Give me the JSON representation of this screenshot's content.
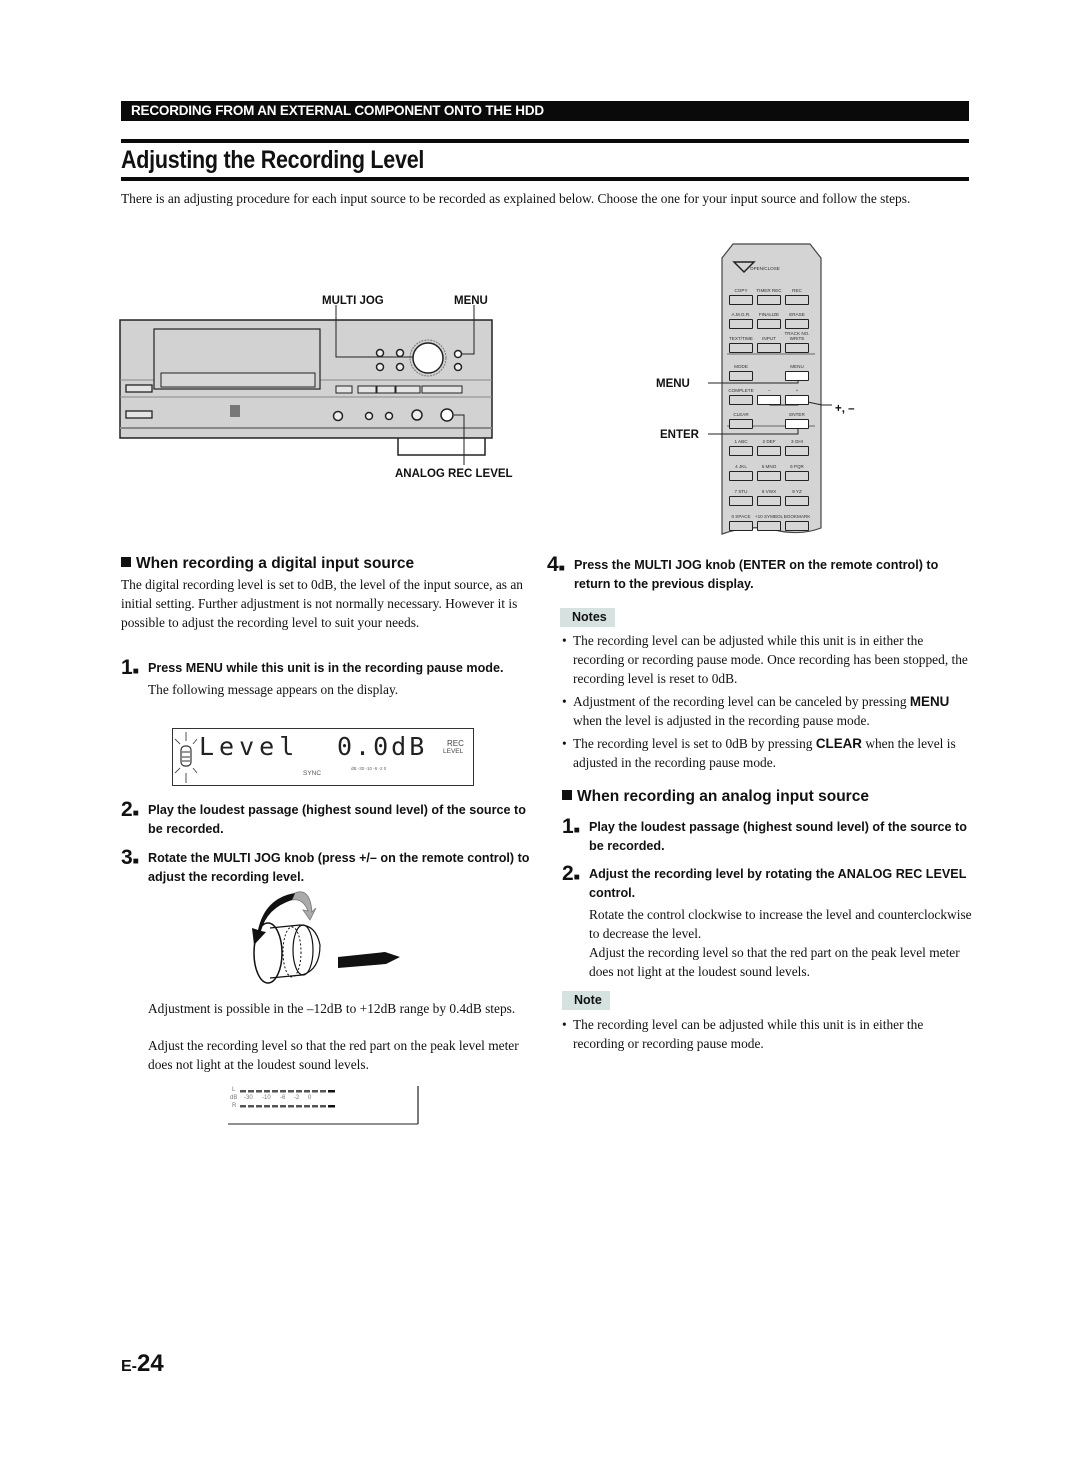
{
  "header": {
    "section_bar": "RECORDING FROM AN EXTERNAL COMPONENT ONTO THE HDD",
    "title": "Adjusting the Recording Level",
    "intro": "There is an adjusting procedure for each input source to be recorded as explained below. Choose the one for your input source and follow the steps."
  },
  "front_panel": {
    "callouts": {
      "multi_jog": "MULTI JOG",
      "menu": "MENU",
      "analog_rec_level": "ANALOG REC LEVEL"
    }
  },
  "remote": {
    "open_close": "OPEN/CLOSE",
    "keys": [
      [
        "COPY",
        "TIMER REC",
        "REC"
      ],
      [
        "A.M.G.R.",
        "FINALIZE",
        "ERASE"
      ],
      [
        "TEXT/TIME",
        "INPUT",
        "TRACK NO. WRITE"
      ],
      [
        "MODE",
        "",
        "MENU"
      ],
      [
        "COMPLETE",
        "–",
        "+"
      ],
      [
        "CLEAR",
        "",
        "ENTER"
      ],
      [
        "1 ABC",
        "2 DEF",
        "3 GHI"
      ],
      [
        "4 JKL",
        "5 MNO",
        "6 PQR"
      ],
      [
        "7 STU",
        "8 VWX",
        "9 YZ"
      ],
      [
        "0 SPACE",
        "+10 SYMBOL",
        "BOOKMARK"
      ]
    ],
    "callouts": {
      "menu": "MENU",
      "enter": "ENTER",
      "plus_minus": "+, –"
    }
  },
  "digital": {
    "heading": "When recording a digital input source",
    "intro": "The digital recording level is set to 0dB, the level of the input source, as an initial setting. Further adjustment is not normally necessary. However it is possible to adjust the recording level to suit your needs.",
    "step1": {
      "num": "1",
      "text": "Press MENU while this unit is in the recording pause mode.",
      "sub": "The following message appears on the display."
    },
    "display": {
      "label": "Level",
      "value": "0.0dB",
      "rec": "REC",
      "level": "LEVEL",
      "sync": "SYNC",
      "meter_scale": "dB -30 -10 -6 -2 0"
    },
    "step2": {
      "num": "2",
      "text": "Play the loudest passage (highest sound level) of the source to be recorded."
    },
    "step3": {
      "num": "3",
      "text": "Rotate the MULTI JOG knob (press +/– on the remote control) to adjust the recording level."
    },
    "para1": "Adjustment is possible in the –12dB to +12dB range by 0.4dB steps.",
    "para2": "Adjust the recording level so that the red part on the peak level meter does not light at the loudest sound levels.",
    "meter": {
      "left": "L",
      "right": "R",
      "db": "dB",
      "ticks": [
        "-30",
        "-10",
        "-6",
        "-2",
        "0"
      ]
    }
  },
  "step4": {
    "num": "4",
    "text": "Press the MULTI JOG knob (ENTER on the remote control) to return to the previous display."
  },
  "notes": {
    "label": "Notes",
    "items": [
      {
        "pre": "The recording level can be adjusted while this unit is in either the recording or recording pause mode. Once recording has been stopped, the recording level is reset to 0dB.",
        "kw": "",
        "post": ""
      },
      {
        "pre": "Adjustment of the recording level can be canceled by pressing ",
        "kw": "MENU",
        "post": " when the level is adjusted in the recording pause mode."
      },
      {
        "pre": "The recording level is set to 0dB by pressing ",
        "kw": "CLEAR",
        "post": " when the level is adjusted in the recording pause mode."
      }
    ]
  },
  "analog": {
    "heading": "When recording an analog input source",
    "step1": {
      "num": "1",
      "text": "Play the loudest passage (highest sound level) of the source to be recorded."
    },
    "step2": {
      "num": "2",
      "text": "Adjust the recording level by rotating the ANALOG REC LEVEL control."
    },
    "para1": "Rotate the control clockwise to increase the level and counterclockwise to decrease the level.",
    "para2": "Adjust the recording level so that the red part on the peak level meter does not light at the loudest sound levels.",
    "note_label": "Note",
    "note": "The recording level can be adjusted while this unit is in either the recording or recording pause mode."
  },
  "footer": {
    "prefix": "E-",
    "number": "24"
  }
}
